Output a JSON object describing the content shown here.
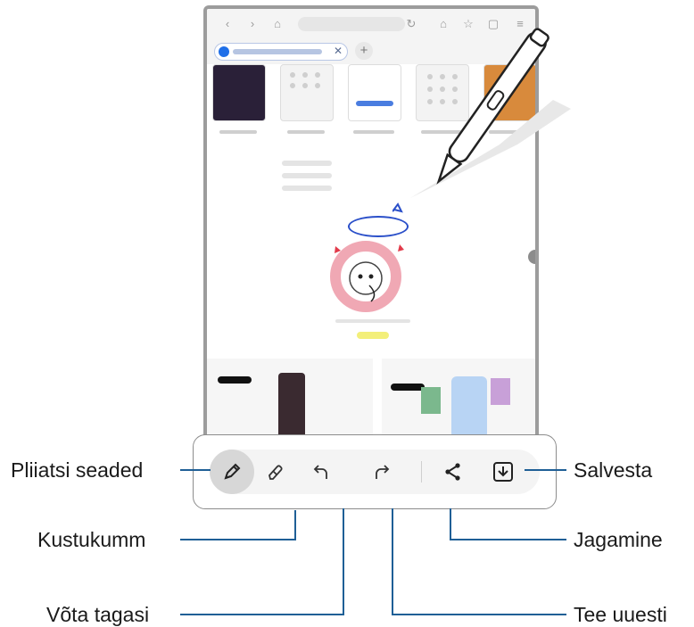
{
  "labels": {
    "pen_settings": "Pliiatsi seaded",
    "eraser": "Kustukumm",
    "undo": "Võta tagasi",
    "redo": "Tee uuesti",
    "share": "Jagamine",
    "save": "Salvesta"
  },
  "toolbar": {
    "tools": [
      {
        "name": "pen-settings",
        "icon": "pen-icon",
        "active": true
      },
      {
        "name": "eraser",
        "icon": "eraser-icon"
      },
      {
        "name": "undo",
        "icon": "undo-icon"
      },
      {
        "name": "redo",
        "icon": "redo-icon"
      },
      {
        "name": "share",
        "icon": "share-icon"
      },
      {
        "name": "save",
        "icon": "save-icon"
      }
    ]
  },
  "colors": {
    "callout_line": "#1f5f96",
    "toolbar_border": "#8c8c8c",
    "active_tool_bg": "#d7d7d7",
    "tab_favicon": "#1f6fe8",
    "sticker_ring": "#f0a8b4",
    "highlight": "#f3ef7a",
    "handwriting": "#2a4fc9"
  }
}
